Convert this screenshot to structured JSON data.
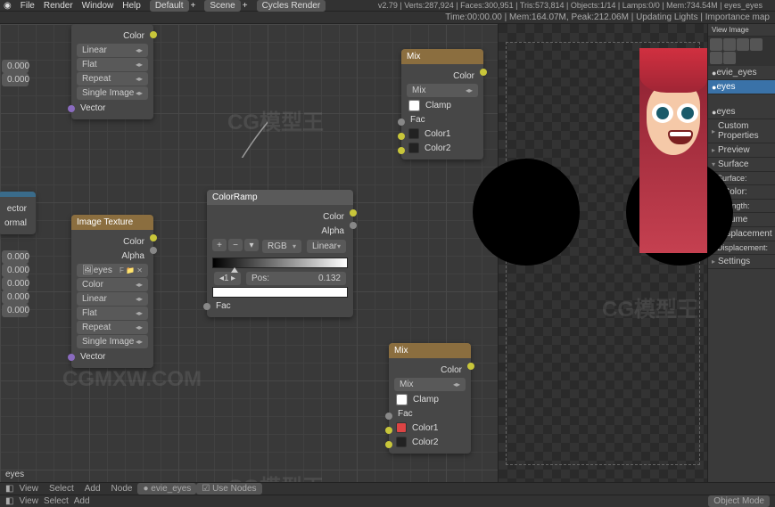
{
  "menubar": {
    "items": [
      "File",
      "Render",
      "Window",
      "Help"
    ],
    "layout": "Default",
    "scene": "Scene",
    "engine": "Cycles Render",
    "stats": "v2.79 | Verts:287,924 | Faces:300,951 | Tris:573,814 | Objects:1/14 | Lamps:0/0 | Mem:734.54M | eyes_eyes"
  },
  "secbar": {
    "text": "Time:00:00.00 | Mem:164.07M, Peak:212.06M | Updating Lights | Importance map"
  },
  "left_partial": {
    "labels": [
      "ector",
      "ormal"
    ],
    "nums": [
      "0.000",
      "0.000",
      "0.000",
      "0.000",
      "0.000",
      "0.000",
      "0.000"
    ]
  },
  "node_tex_a": {
    "title": "",
    "dd": [
      "Linear",
      "Flat",
      "Repeat",
      "Single Image"
    ],
    "out_vector": "Vector",
    "out_color": "Color"
  },
  "node_img_tex": {
    "title": "Image Texture",
    "out_color": "Color",
    "out_alpha": "Alpha",
    "img": "eyes",
    "dd": [
      "Color",
      "Linear",
      "Flat",
      "Repeat",
      "Single Image"
    ],
    "vector": "Vector"
  },
  "node_colorramp": {
    "title": "ColorRamp",
    "out_color": "Color",
    "out_alpha": "Alpha",
    "mode1": "RGB",
    "mode2": "Linear",
    "idx": "1",
    "pos_label": "Pos:",
    "pos_val": "0.132",
    "fac": "Fac"
  },
  "node_mix_a": {
    "title": "Mix",
    "out_color": "Color",
    "blend": "Mix",
    "fac": "Fac",
    "clamp": "Clamp",
    "c1": "Color1",
    "c2": "Color2"
  },
  "node_mix_b": {
    "title": "Mix",
    "out_color": "Color",
    "blend": "Mix",
    "fac": "Fac",
    "clamp": "Clamp",
    "c1": "Color1",
    "c2": "Color2"
  },
  "props": {
    "header": "View   Image",
    "material": "evie_eyes",
    "active": "eyes",
    "panel_eyes": "eyes",
    "sections": [
      "Custom Properties",
      "Preview",
      "Surface"
    ],
    "surface_lbl": "Surface:",
    "sub": [
      "Color:",
      "Strength:"
    ],
    "sections2": [
      "Volume",
      "Displacement"
    ],
    "disp_lbl": "Displacement:",
    "sections3": [
      "Settings"
    ]
  },
  "bottom": {
    "breadcrumb": "eyes",
    "view": "View",
    "select": "Select",
    "add": "Add",
    "node": "Node",
    "mat": "evie_eyes",
    "use_nodes": "Use Nodes",
    "obj_mode": "Object Mode"
  },
  "colors": {
    "pupil": "#e04a4a",
    "mix_b_c1": "#d44"
  }
}
